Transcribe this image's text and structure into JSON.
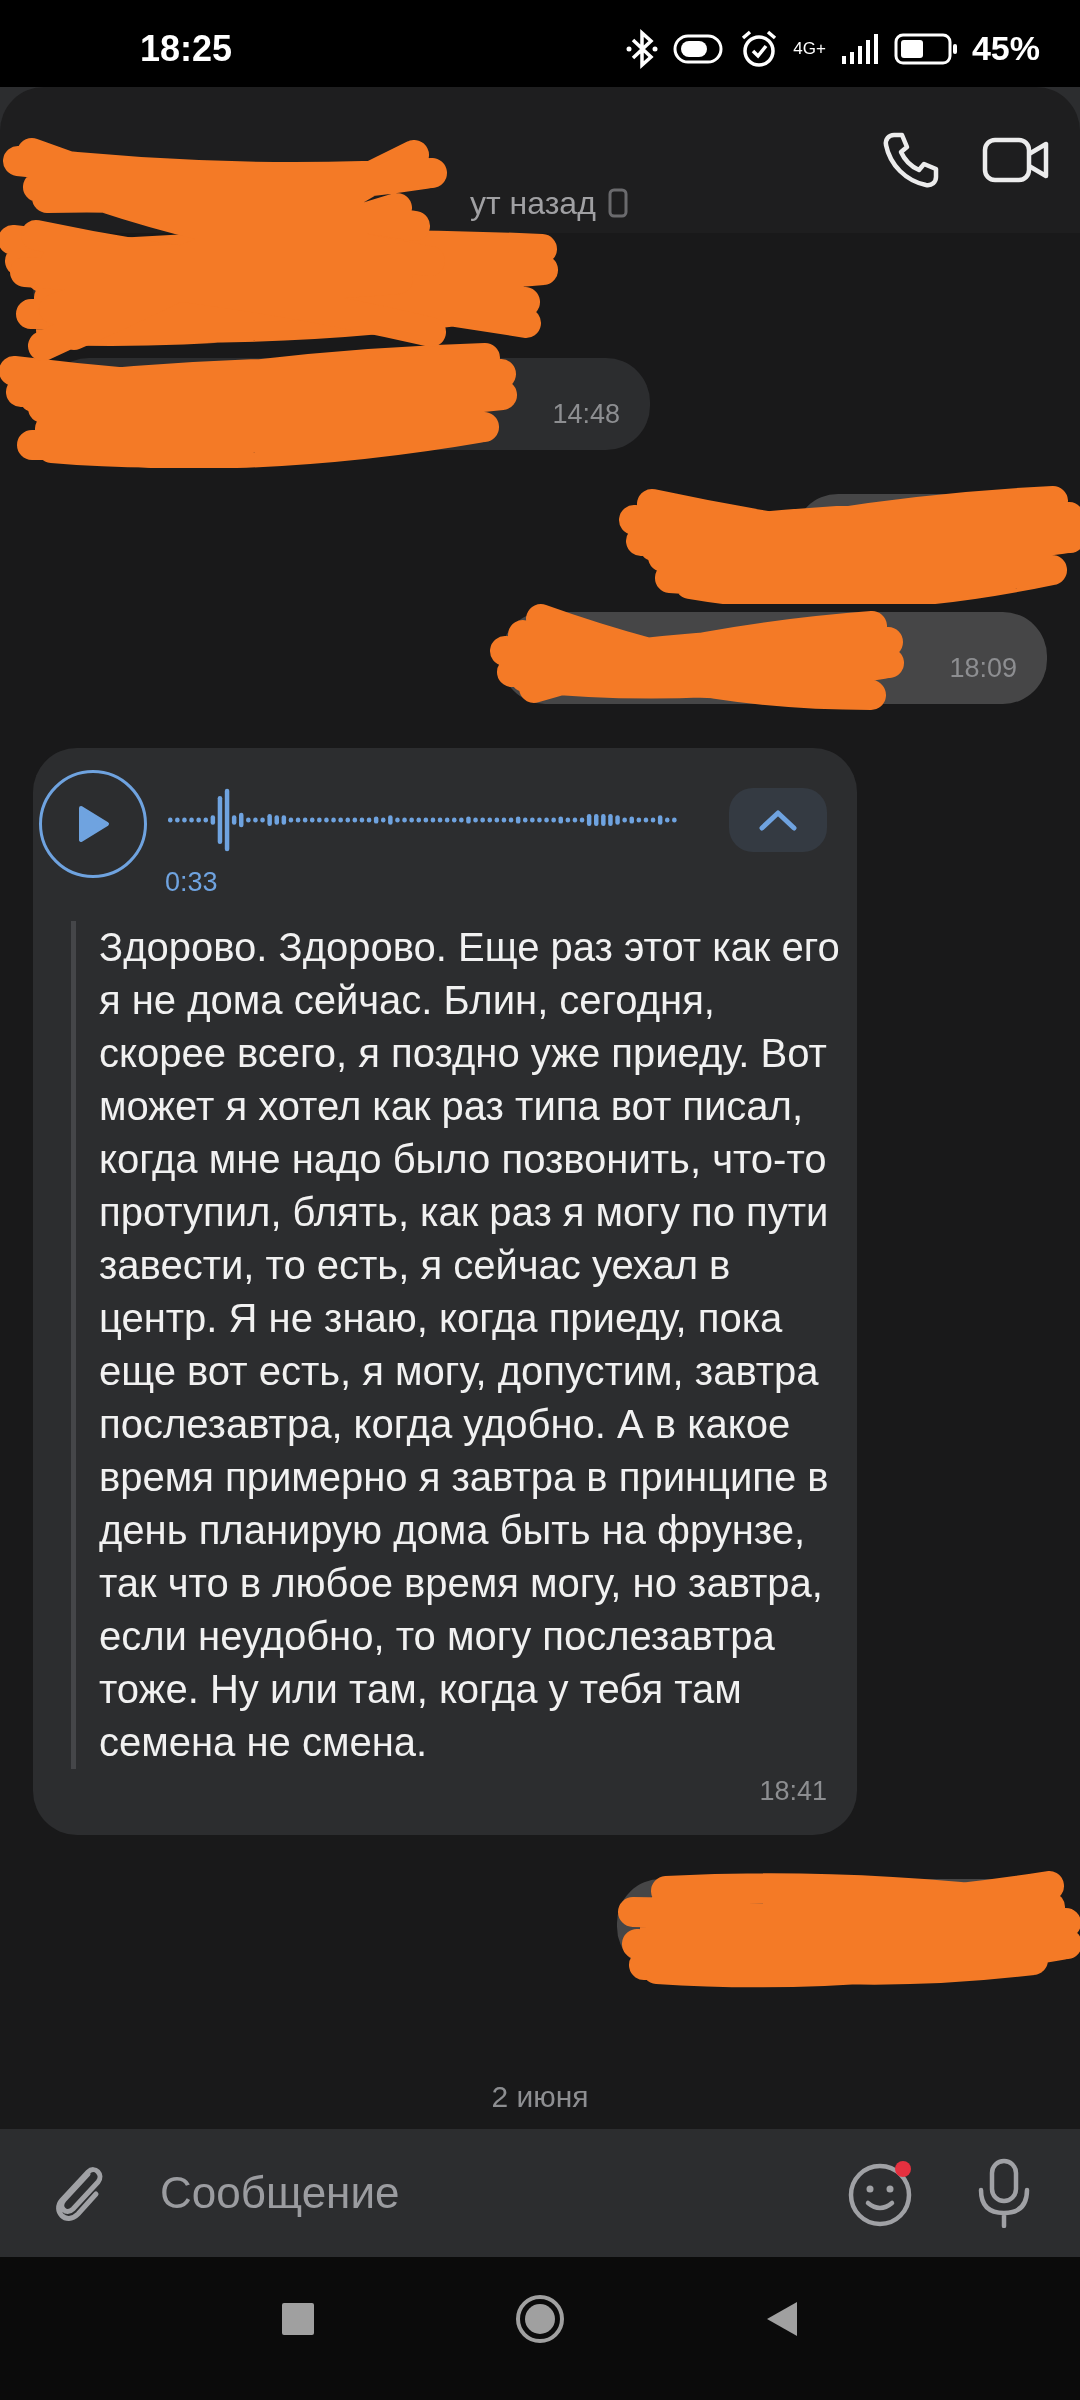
{
  "status_bar": {
    "time": "18:25",
    "network": "4G+",
    "battery": "45%"
  },
  "header": {
    "redacted": true,
    "status": "ут назад"
  },
  "messages": [
    {
      "kind": "text",
      "outgoing": false,
      "redacted": true
    },
    {
      "kind": "text",
      "outgoing": false,
      "redacted": true,
      "time": "14:48"
    },
    {
      "kind": "text",
      "outgoing": true,
      "redacted": true
    },
    {
      "kind": "text",
      "outgoing": true,
      "redacted": true,
      "time": "18:09"
    },
    {
      "kind": "voice",
      "outgoing": false,
      "duration": "0:33",
      "transcript_expanded": true,
      "transcript": "Здорово. Здорово. Еще раз этот как его я не дома сейчас. Блин, сегодня, скорее всего, я поздно уже приеду. Вот может я хотел как раз типа вот писал, когда мне надо было позвонить, что-то протупил, блять, как раз я могу по пути завести, то есть, я сейчас уехал в центр. Я не знаю, когда приеду, пока еще вот есть, я могу, допустим, завтра послезавтра, когда удобно. А в какое время примерно я завтра в принципе в день планирую дома быть на фрунзе, так что в любое время могу, но завтра, если неудобно, то могу послезавтра тоже. Ну или там, когда у тебя там семена не смена.",
      "time": "18:41"
    },
    {
      "kind": "text",
      "outgoing": true,
      "redacted": true
    }
  ],
  "date_separator": "2 июня",
  "composer": {
    "placeholder": "Сообщение",
    "emoji_notification": true
  }
}
